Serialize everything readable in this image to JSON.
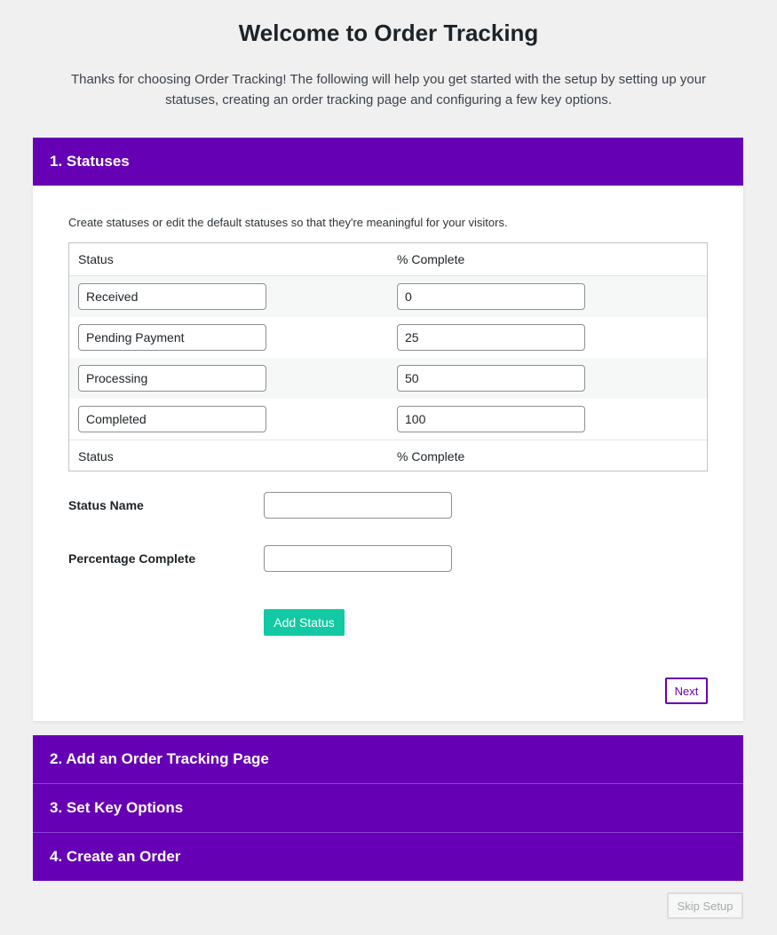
{
  "page": {
    "title": "Welcome to Order Tracking",
    "intro": "Thanks for choosing Order Tracking! The following will help you get started with the setup by setting up your statuses, creating an order tracking page and configuring a few key options."
  },
  "steps": [
    {
      "label": "1. Statuses",
      "expanded": true
    },
    {
      "label": "2. Add an Order Tracking Page",
      "expanded": false
    },
    {
      "label": "3. Set Key Options",
      "expanded": false
    },
    {
      "label": "4. Create an Order",
      "expanded": false
    }
  ],
  "statuses": {
    "description": "Create statuses or edit the default statuses so that they're meaningful for your visitors.",
    "columns": [
      "Status",
      "% Complete"
    ],
    "rows": [
      {
        "status": "Received",
        "percent": "0"
      },
      {
        "status": "Pending Payment",
        "percent": "25"
      },
      {
        "status": "Processing",
        "percent": "50"
      },
      {
        "status": "Completed",
        "percent": "100"
      }
    ],
    "form": {
      "status_name_label": "Status Name",
      "status_name_value": "",
      "percentage_label": "Percentage Complete",
      "percentage_value": "",
      "add_button": "Add Status"
    },
    "next_button": "Next"
  },
  "footer": {
    "skip_button": "Skip Setup"
  },
  "colors": {
    "accent": "#6600b4",
    "add_button": "#13c9a3",
    "background": "#f0f0f1"
  }
}
